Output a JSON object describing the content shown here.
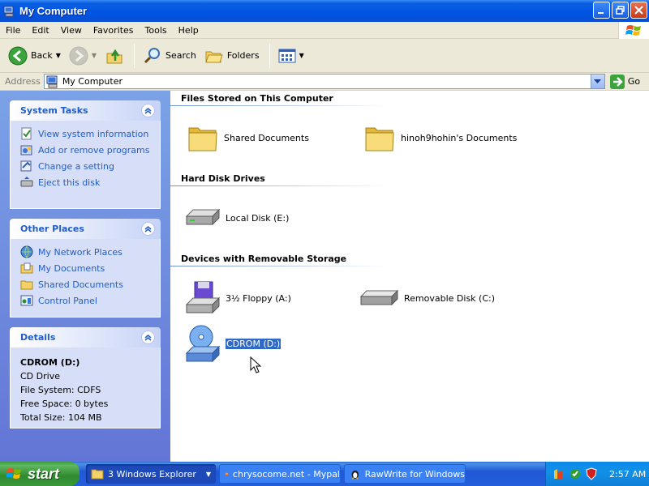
{
  "window": {
    "title": "My Computer"
  },
  "menu": [
    "File",
    "Edit",
    "View",
    "Favorites",
    "Tools",
    "Help"
  ],
  "toolbar": {
    "back": "Back",
    "search": "Search",
    "folders": "Folders"
  },
  "address": {
    "label": "Address",
    "value": "My Computer",
    "go": "Go"
  },
  "task_pane": {
    "system_tasks": {
      "title": "System Tasks",
      "items": [
        "View system information",
        "Add or remove programs",
        "Change a setting",
        "Eject this disk"
      ]
    },
    "other_places": {
      "title": "Other Places",
      "items": [
        "My Network Places",
        "My Documents",
        "Shared Documents",
        "Control Panel"
      ]
    },
    "details": {
      "title": "Details",
      "name": "CDROM (D:)",
      "type": "CD Drive",
      "file_system": "File System: CDFS",
      "free_space": "Free Space: 0 bytes",
      "total_size": "Total Size: 104 MB"
    }
  },
  "content": {
    "groups": [
      {
        "title": "Files Stored on This Computer",
        "items": [
          "Shared Documents",
          "hinoh9hohin's Documents"
        ]
      },
      {
        "title": "Hard Disk Drives",
        "items": [
          "Local Disk (E:)"
        ]
      },
      {
        "title": "Devices with Removable Storage",
        "items": [
          "3½ Floppy (A:)",
          "Removable Disk (C:)",
          "CDROM (D:)"
        ]
      }
    ],
    "selected_item": "CDROM (D:)"
  },
  "taskbar": {
    "start": "start",
    "buttons": [
      "3 Windows Explorer",
      "chrysocome.net - Mypal",
      "RawWrite for Windows"
    ],
    "clock": "2:57 AM"
  },
  "colors": {
    "title_blue": "#0054e3",
    "link_blue": "#215dc6",
    "selection": "#316ac5",
    "start_green": "#3c9a3c"
  }
}
